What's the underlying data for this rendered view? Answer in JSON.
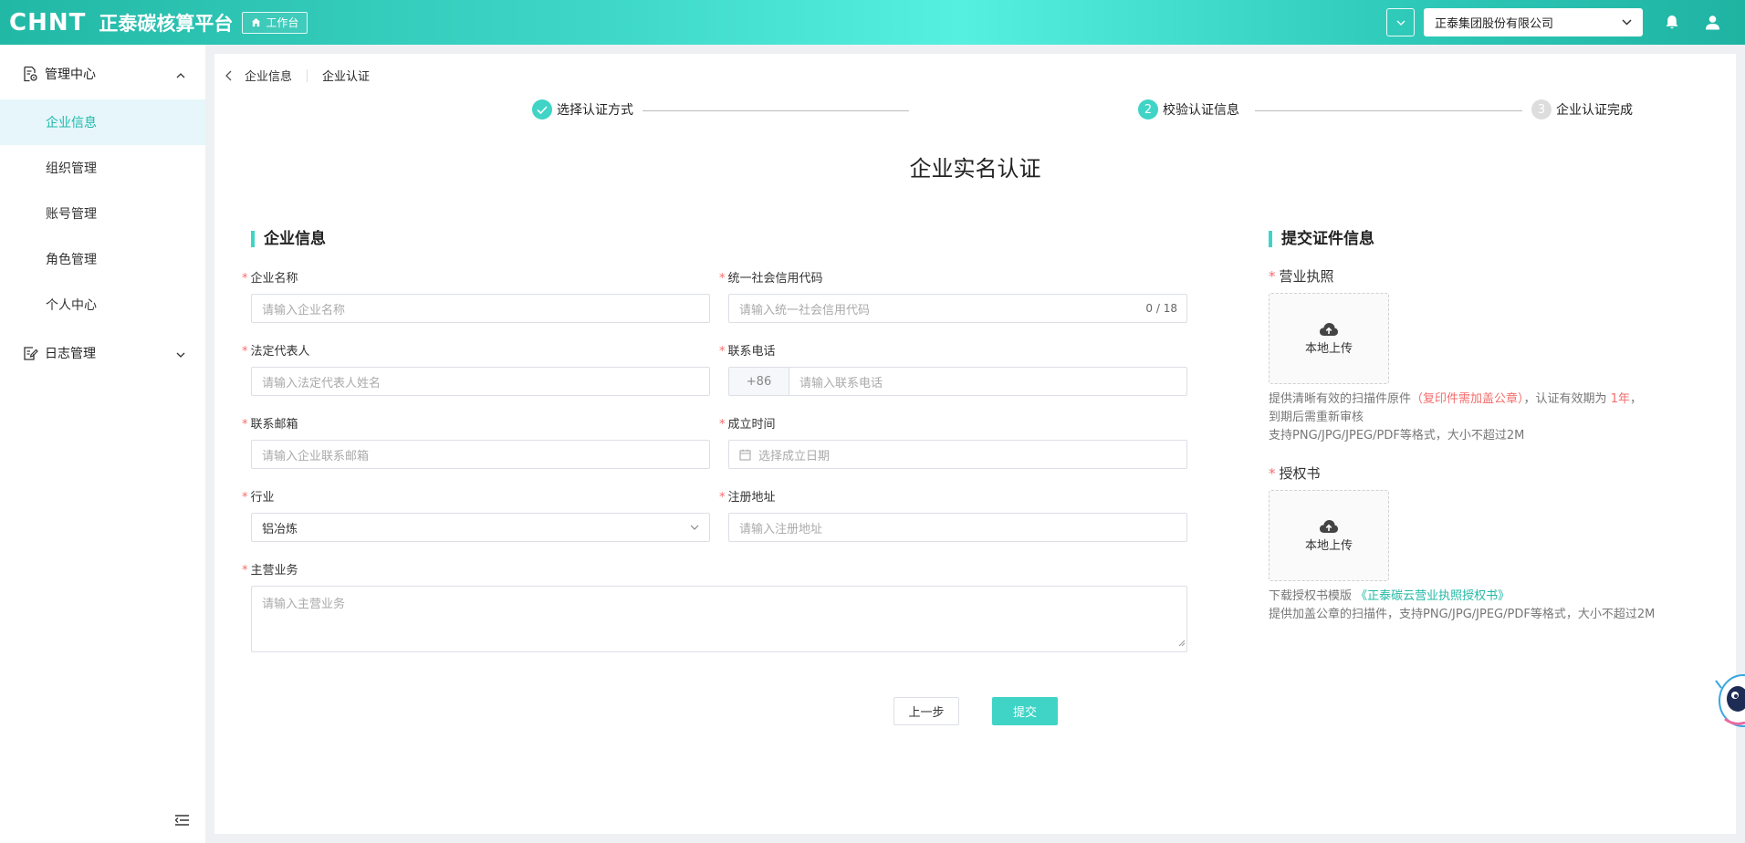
{
  "header": {
    "logo_text": "CHNT",
    "platform_name": "正泰碳核算平台",
    "workbench_label": "工作台",
    "company_selected": "正泰集团股份有限公司"
  },
  "sidebar": {
    "groups": [
      {
        "label": "管理中心",
        "items": [
          "企业信息",
          "组织管理",
          "账号管理",
          "角色管理",
          "个人中心"
        ]
      },
      {
        "label": "日志管理",
        "items": []
      }
    ],
    "active_item": "企业信息"
  },
  "breadcrumb": [
    "企业信息",
    "企业认证"
  ],
  "steps": [
    {
      "number": "1",
      "label": "选择认证方式",
      "status": "done"
    },
    {
      "number": "2",
      "label": "校验认证信息",
      "status": "current"
    },
    {
      "number": "3",
      "label": "企业认证完成",
      "status": "wait"
    }
  ],
  "form_title": "企业实名认证",
  "company_section": {
    "title": "企业信息",
    "fields": {
      "company_name": {
        "label": "企业名称",
        "placeholder": "请输入企业名称"
      },
      "credit_code": {
        "label": "统一社会信用代码",
        "placeholder": "请输入统一社会信用代码",
        "counter": "0 / 18"
      },
      "legal_rep": {
        "label": "法定代表人",
        "placeholder": "请输入法定代表人姓名"
      },
      "phone": {
        "label": "联系电话",
        "prefix": "+86",
        "placeholder": "请输入联系电话"
      },
      "email": {
        "label": "联系邮箱",
        "placeholder": "请输入企业联系邮箱"
      },
      "founded": {
        "label": "成立时间",
        "placeholder": "选择成立日期"
      },
      "industry": {
        "label": "行业",
        "value": "铝冶炼"
      },
      "address": {
        "label": "注册地址",
        "placeholder": "请输入注册地址"
      },
      "business": {
        "label": "主营业务",
        "placeholder": "请输入主营业务"
      }
    }
  },
  "buttons": {
    "prev": "上一步",
    "submit": "提交"
  },
  "cert_section": {
    "title": "提交证件信息",
    "license": {
      "label": "营业执照",
      "upload_label": "本地上传",
      "hint_1": "提供清晰有效的扫描件原件",
      "hint_red": "（复印件需加盖公章）",
      "hint_2": "，认证有效期为",
      "hint_year": "1年",
      "hint_3": "，",
      "hint_line2": "到期后需重新审核",
      "hint_line3": "支持PNG/JPG/JPEG/PDF等格式，大小不超过2M"
    },
    "authorization": {
      "label": "授权书",
      "upload_label": "本地上传",
      "download_prefix": "下载授权书模版",
      "download_link": "《正泰碳云营业执照授权书》",
      "hint": "提供加盖公章的扫描件，支持PNG/JPG/JPEG/PDF等格式，大小不超过2M"
    }
  },
  "colors": {
    "accent": "#3fd4c6",
    "required": "#f56c6c",
    "active_menu_bg": "#e6f6fa"
  }
}
